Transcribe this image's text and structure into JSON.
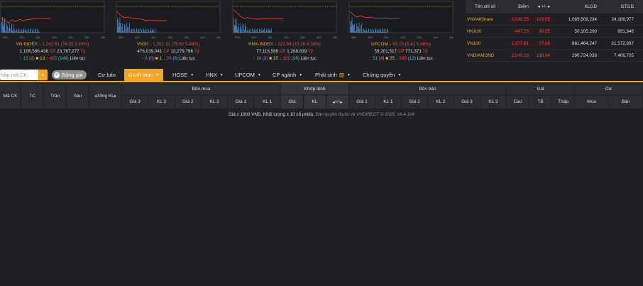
{
  "indices": [
    {
      "name": "VN-INDEX",
      "value": "1,242.91",
      "change": "(74.92 5.69%)",
      "volume": "1,106,586,436",
      "cp_label": "CP",
      "cp": "23,767,277",
      "unit": "Tỷ",
      "up": "13",
      "ceil": "(2)",
      "ref": "13",
      "down": "485",
      "floor": "(148)",
      "status": "Liên tục",
      "series": [
        0.55,
        0.62,
        0.7,
        0.6,
        0.66,
        0.58,
        0.62,
        0.6,
        0.58,
        0.56,
        0.55,
        0.55,
        0.56,
        0.55,
        0.55
      ]
    },
    {
      "name": "VN30",
      "value": "1,301.32",
      "change": "(75.62 5.49%)",
      "volume": "476,039,041",
      "cp_label": "CP",
      "cp": "13,279,766",
      "unit": "Tỷ",
      "up": "0",
      "ceil": "(0)",
      "ref": "1",
      "down": "29",
      "floor": "(8)",
      "status": "Liên tục",
      "series": [
        0.3,
        0.45,
        0.52,
        0.5,
        0.55,
        0.56,
        0.55,
        0.58,
        0.62,
        0.6,
        0.61,
        0.63,
        0.62,
        0.62,
        0.63
      ]
    },
    {
      "name": "HNX-INDEX",
      "value": "222.94",
      "change": "(15.19 6.38%)",
      "volume": "77,116,586",
      "cp_label": "CP",
      "cp": "1,268,839",
      "unit": "Tỷ",
      "up": "10",
      "ceil": "(2)",
      "ref": "15",
      "down": "185",
      "floor": "(26)",
      "status": "Liên tục",
      "series": [
        0.25,
        0.35,
        0.48,
        0.55,
        0.52,
        0.55,
        0.56,
        0.58,
        0.56,
        0.57,
        0.55,
        0.56,
        0.55,
        0.56,
        0.56
      ]
    },
    {
      "name": "UPCOM",
      "value": "93.23",
      "change": "(5.41 5.48%)",
      "volume": "59,201,517",
      "cp_label": "CP",
      "cp": "771,371",
      "unit": "Tỷ",
      "up": "51",
      "ceil": "(4)",
      "ref": "25",
      "down": "280",
      "floor": "(13)",
      "status": "Liên tục",
      "series": [
        0.3,
        0.42,
        0.5,
        0.46,
        0.5,
        0.52,
        0.5,
        0.54,
        0.53,
        0.55,
        0.53,
        0.54,
        0.55,
        0.54,
        0.55
      ]
    }
  ],
  "chart_axis": [
    "09h",
    "10h",
    "11h",
    "12h",
    "13h",
    "14h",
    "15h"
  ],
  "summary": {
    "headers": [
      "Tên chỉ số",
      "Điểm",
      "+/-",
      "KLGD",
      "GTGD"
    ],
    "sort_icon": "◂ ▸",
    "rows": [
      {
        "name": "VNXAllShare",
        "point": "2,039.25",
        "change": "123.65",
        "vol": "1,069,509,234",
        "val": "24,189,977"
      },
      {
        "name": "HNX30",
        "point": "447.76",
        "change": "39.05",
        "vol": "50,105,200",
        "val": "991,846"
      },
      {
        "name": "VN100",
        "point": "1,277.81",
        "change": "77.66",
        "vol": "881,464,247",
        "val": "21,572,897"
      },
      {
        "name": "VNDIAMOND",
        "point": "2,045.18",
        "change": "138.04",
        "vol": "290,724,038",
        "val": "7,406,705"
      }
    ]
  },
  "toolbar": {
    "search_placeholder": "hập mã CK...",
    "add": "+",
    "board": "Bảng giá",
    "tabs": [
      "Cơ bản",
      "Danh mục",
      "HOSE",
      "HNX",
      "UPCOM",
      "CP ngành",
      "Phái sinh",
      "Chứng quyền"
    ]
  },
  "grid": {
    "fixed": [
      "Mã CK",
      "TC",
      "Trần",
      "Sàn",
      "Tổng KL"
    ],
    "groups": [
      "Bên mua",
      "Khớp lệnh",
      "Bên bán",
      "Giá",
      "Dư"
    ],
    "buy": [
      "Giá 3",
      "KL 3",
      "Giá 2",
      "KL 2",
      "Giá 1",
      "KL 1"
    ],
    "match": [
      "Giá",
      "KL",
      "+/-"
    ],
    "sell": [
      "Giá 1",
      "KL 1",
      "Giá 2",
      "KL 2",
      "Giá 3",
      "KL 3"
    ],
    "price": [
      "Cao",
      "TB",
      "Thấp"
    ],
    "remain": [
      "Mua",
      "Bán"
    ]
  },
  "footer": {
    "note": "Giá x 1000 VNĐ. Khối lượng x 10 cổ phiếu.",
    "copyright": "Bản quyền thuộc về VNDIRECT © 2025. v4.4.104"
  },
  "colors": {
    "accent": "#f5a623",
    "down": "#ff3b3b",
    "up": "#27d427",
    "ref": "#f2d000",
    "ceil": "#d65bd6",
    "floor": "#29c6e8"
  }
}
